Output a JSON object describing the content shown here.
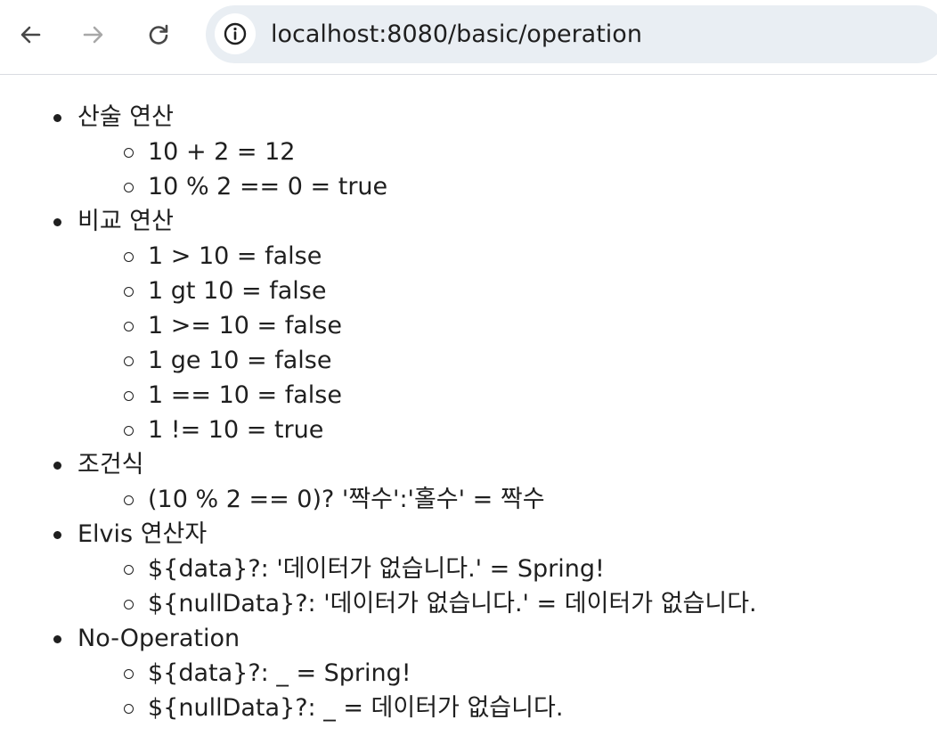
{
  "browser": {
    "url": "localhost:8080/basic/operation"
  },
  "sections": [
    {
      "title": "산술 연산",
      "items": [
        "10 + 2 = 12",
        "10 % 2 == 0 = true"
      ]
    },
    {
      "title": "비교 연산",
      "items": [
        "1 > 10 = false",
        "1 gt 10 = false",
        "1 >= 10 = false",
        "1 ge 10 = false",
        "1 == 10 = false",
        "1 != 10 = true"
      ]
    },
    {
      "title": "조건식",
      "items": [
        "(10 % 2 == 0)? '짝수':'홀수' = 짝수"
      ]
    },
    {
      "title": "Elvis 연산자",
      "items": [
        "${data}?: '데이터가 없습니다.' = Spring!",
        "${nullData}?: '데이터가 없습니다.' = 데이터가 없습니다."
      ]
    },
    {
      "title": "No-Operation",
      "items": [
        "${data}?: _ = Spring!",
        "${nullData}?: _ = 데이터가 없습니다."
      ]
    }
  ]
}
